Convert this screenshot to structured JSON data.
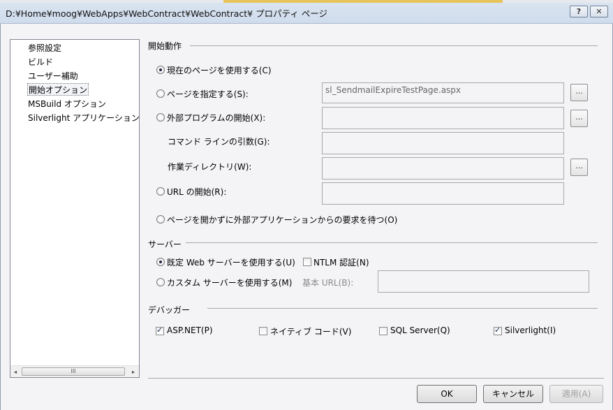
{
  "window": {
    "title": "D:¥Home¥moog¥WebApps¥WebContract¥WebContract¥ プロパティ ページ",
    "help_label": "?",
    "close_label": "✕"
  },
  "sidebar": {
    "items": [
      {
        "label": "参照設定"
      },
      {
        "label": "ビルド"
      },
      {
        "label": "ユーザー補助"
      },
      {
        "label": "開始オプション"
      },
      {
        "label": "MSBuild オプション"
      },
      {
        "label": "Silverlight アプリケーション"
      }
    ],
    "selected_index": 3,
    "scroll_left": "◂",
    "scroll_thumb": "III",
    "scroll_right": "▸"
  },
  "start_action": {
    "heading": "開始動作",
    "current_page": "現在のページを使用する(C)",
    "specific_page": "ページを指定する(S):",
    "specific_page_value": "sl_SendmailExpireTestPage.aspx",
    "external_program": "外部プログラムの開始(X):",
    "cmdline_args": "コマンド ラインの引数(G):",
    "working_dir": "作業ディレクトリ(W):",
    "start_url": "URL の開始(R):",
    "wait_external": "ページを開かずに外部アプリケーションからの要求を待つ(O)",
    "browse_label": "..."
  },
  "server": {
    "heading": "サーバー",
    "default_web": "既定 Web サーバーを使用する(U)",
    "ntlm": "NTLM 認証(N)",
    "custom_server": "カスタム サーバーを使用する(M)",
    "base_url": "基本 URL(B):"
  },
  "debugger": {
    "heading": "デバッガー",
    "aspnet": "ASP.NET(P)",
    "native": "ネイティブ コード(V)",
    "sql": "SQL Server(Q)",
    "silverlight": "Silverlight(I)"
  },
  "buttons": {
    "ok": "OK",
    "cancel": "キャンセル",
    "apply": "適用(A)"
  }
}
